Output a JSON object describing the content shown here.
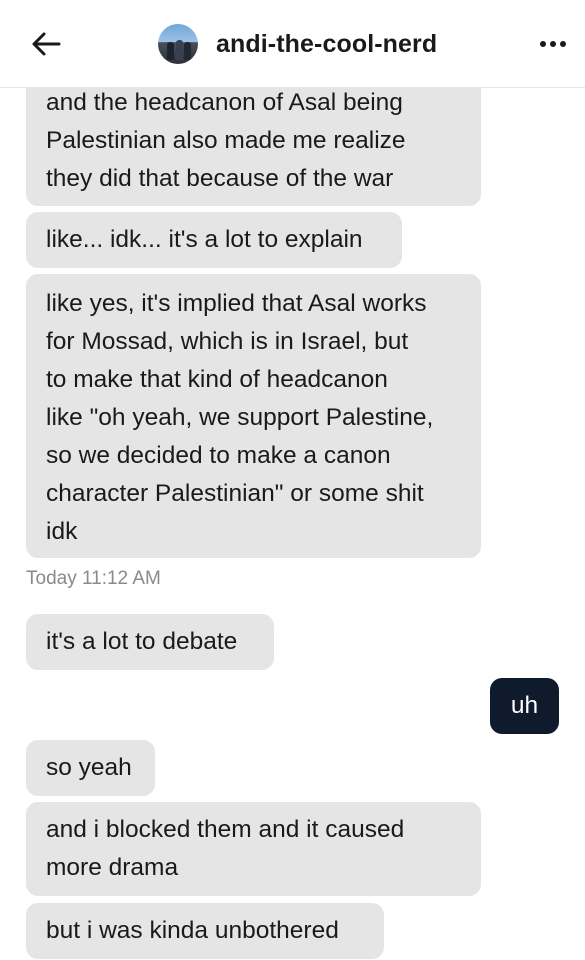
{
  "header": {
    "title": "andi-the-cool-nerd",
    "back_icon": "arrow-left-icon",
    "more_icon": "more-horizontal-icon"
  },
  "messages": [
    {
      "direction": "in",
      "lines": [
        "and the headcanon of Asal being",
        "Palestinian also made me realize",
        "they did that because of the war"
      ]
    },
    {
      "direction": "in",
      "lines": [
        "like... idk... it's a lot to explain"
      ]
    },
    {
      "direction": "in",
      "lines": [
        "like yes, it's implied that Asal works",
        "for Mossad, which is in Israel, but",
        "to make that kind of headcanon",
        "like \"oh yeah, we support Palestine,",
        "so we decided to make a canon",
        "character Palestinian\" or some shit",
        "idk"
      ]
    },
    {
      "direction": "in",
      "lines": [
        "it's a lot to debate"
      ]
    },
    {
      "direction": "out",
      "lines": [
        "uh"
      ]
    },
    {
      "direction": "in",
      "lines": [
        "so yeah"
      ]
    },
    {
      "direction": "in",
      "lines": [
        "and i blocked them and it caused",
        "more drama"
      ]
    },
    {
      "direction": "in",
      "lines": [
        "but i was kinda unbothered"
      ]
    }
  ],
  "timestamp": "Today 11:12 AM",
  "colors": {
    "incoming_bubble": "#e5e5e5",
    "outgoing_bubble": "#0f1a2c",
    "timestamp_text": "#8a8a8a"
  }
}
